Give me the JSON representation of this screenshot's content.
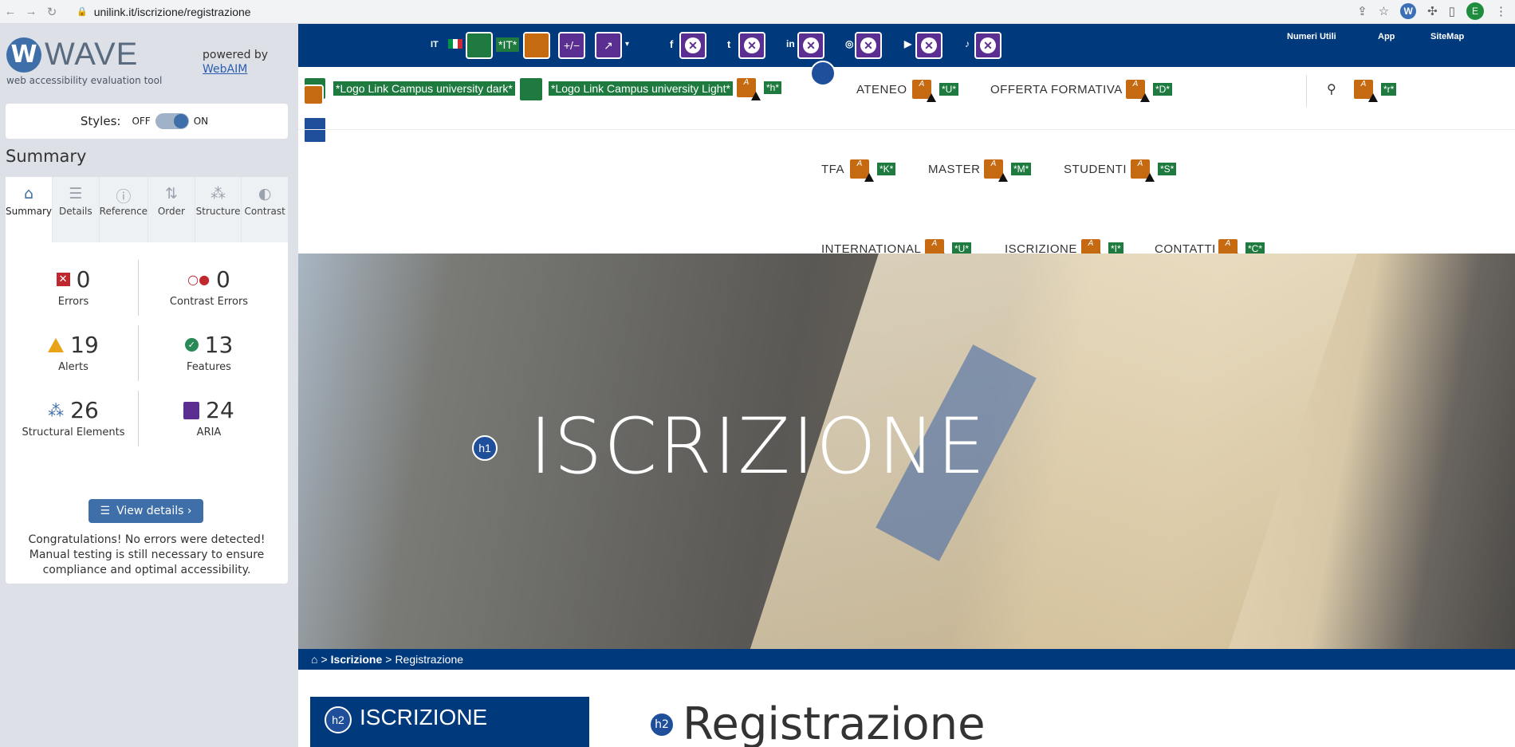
{
  "browser": {
    "url": "unilink.it/iscrizione/registrazione",
    "avatar_letter": "E",
    "wave_ext_letter": "W"
  },
  "wave": {
    "brand": "WAVE",
    "tagline": "web accessibility evaluation tool",
    "powered_by": "powered by",
    "webaim": "WebAIM",
    "styles_label": "Styles:",
    "off": "OFF",
    "on": "ON",
    "summary_title": "Summary",
    "tabs": [
      {
        "label": "Summary",
        "icon": "home-icon"
      },
      {
        "label": "Details",
        "icon": "list-icon"
      },
      {
        "label": "Reference",
        "icon": "info-icon"
      },
      {
        "label": "Order",
        "icon": "order-icon"
      },
      {
        "label": "Structure",
        "icon": "structure-icon"
      },
      {
        "label": "Contrast",
        "icon": "contrast-icon"
      }
    ],
    "stats": {
      "errors": {
        "value": "0",
        "label": "Errors"
      },
      "contrast": {
        "value": "0",
        "label": "Contrast Errors"
      },
      "alerts": {
        "value": "19",
        "label": "Alerts"
      },
      "features": {
        "value": "13",
        "label": "Features"
      },
      "structural": {
        "value": "26",
        "label": "Structural Elements"
      },
      "aria": {
        "value": "24",
        "label": "ARIA"
      }
    },
    "view_details": "View details ›",
    "congrats": "Congratulations! No errors were detected! Manual testing is still necessary to ensure compliance and optimal accessibility."
  },
  "site": {
    "lang": "IT",
    "alt_it": "*IT*",
    "top_links": [
      "Numeri Utili",
      "App",
      "SiteMap"
    ],
    "logo_dark": "*Logo Link Campus university dark*",
    "logo_light": "*Logo Link Campus university Light*",
    "tag_h": "*h*",
    "tag_r": "*r*",
    "nav": [
      {
        "label": "ATENEO",
        "tag": "*U*"
      },
      {
        "label": "OFFERTA FORMATIVA",
        "tag": "*D*"
      },
      {
        "label": "TFA",
        "tag": "*K*"
      },
      {
        "label": "MASTER",
        "tag": "*M*"
      },
      {
        "label": "STUDENTI",
        "tag": "*S*"
      },
      {
        "label": "INTERNATIONAL",
        "tag": "*U*"
      },
      {
        "label": "ISCRIZIONE",
        "tag": "*I*"
      },
      {
        "label": "CONTATTI",
        "tag": "*C*"
      }
    ],
    "hero_title": "ISCRIZIONE",
    "h1": "h1",
    "h2": "h2",
    "breadcrumb": {
      "sep": ">",
      "parent": "Iscrizione",
      "current": "Registrazione"
    },
    "side_title": "ISCRIZIONE",
    "page_title": "Registrazione"
  },
  "colors": {
    "wave_blue": "#3f6fa8",
    "site_navy": "#003a7d",
    "alert": "#e8a317",
    "aria": "#5b2f91"
  }
}
